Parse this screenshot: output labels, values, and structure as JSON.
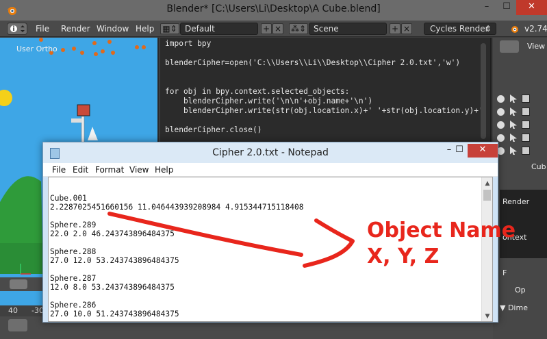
{
  "blender": {
    "window_title": "Blender* [C:\\Users\\Li\\Desktop\\A Cube.blend]",
    "window_controls": {
      "minimize": "–",
      "maximize": "☐",
      "close": "✕"
    },
    "menus": [
      "File",
      "Render",
      "Window",
      "Help"
    ],
    "screen_layout": "Default",
    "scene": "Scene",
    "render_engine": "Cycles Render",
    "version": "v2.74",
    "viewport_label": "User Ortho",
    "view_label": "View",
    "side_labels": {
      "cube_label": "Cub",
      "render_label": "Render",
      "context_label": "ontext",
      "f_label": "F",
      "op_label": "Op",
      "dims_label": "▼ Dime"
    },
    "timeline": {
      "ruler_values": [
        "40",
        "-30"
      ]
    },
    "script_lines": [
      "import bpy",
      "",
      "blenderCipher=open('C:\\\\Users\\\\Li\\\\Desktop\\\\Cipher 2.0.txt','w')",
      "",
      "",
      "for obj in bpy.context.selected_objects:",
      "    blenderCipher.write('\\n\\n'+obj.name+'\\n')",
      "    blenderCipher.write(str(obj.location.x)+' '+str(obj.location.y)+'",
      "",
      "blenderCipher.close()"
    ]
  },
  "notepad": {
    "title": "Cipher 2.0.txt - Notepad",
    "menus": [
      "File",
      "Edit",
      "Format",
      "View",
      "Help"
    ],
    "window_controls": {
      "minimize": "–",
      "maximize": "☐",
      "close": "✕"
    },
    "content_lines": [
      "Cube.001",
      "2.2287025451660156 11.046443939208984 4.915344715118408",
      "",
      "Sphere.289",
      "22.0 2.0 46.243743896484375",
      "",
      "Sphere.288",
      "27.0 12.0 53.243743896484375",
      "",
      "Sphere.287",
      "12.0 8.0 53.243743896484375",
      "",
      "Sphere.286",
      "27.0 10.0 51.243743896484375"
    ]
  },
  "annotation": {
    "line1": "Object Name",
    "line2": "X, Y, Z",
    "color": "#e8261c"
  }
}
